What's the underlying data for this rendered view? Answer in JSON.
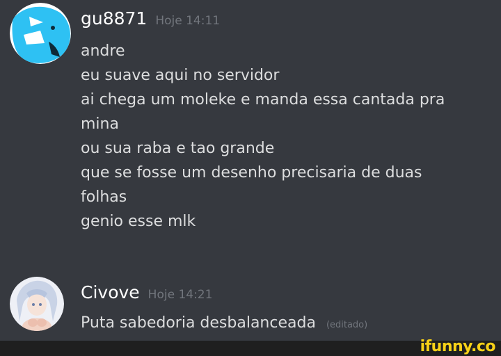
{
  "messages": [
    {
      "username": "gu8871",
      "timestamp": "Hoje 14:11",
      "lines": [
        "andre",
        "eu suave aqui no servidor",
        "ai chega um moleke e manda essa cantada pra",
        "mina",
        "ou sua raba e tao grande",
        "que se fosse um desenho precisaria de duas",
        "folhas",
        "genio esse mlk"
      ]
    },
    {
      "username": "Civove",
      "timestamp": "Hoje 14:21",
      "lines": [
        "Puta sabedoria desbalanceada"
      ],
      "edited_label": "(editado)"
    }
  ],
  "watermark": "ifunny.co",
  "colors": {
    "background": "#36393f",
    "username": "#ffffff",
    "text": "#dcddde",
    "muted": "#72767d",
    "watermark": "#f8d117"
  }
}
